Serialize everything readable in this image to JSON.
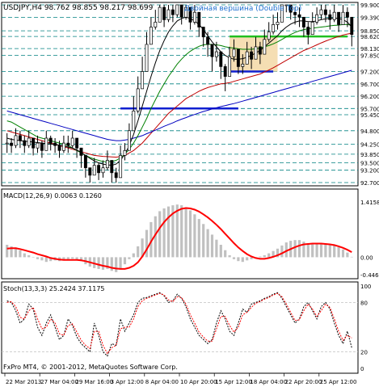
{
  "chart_data": [
    {
      "type": "candlestick",
      "panel": "price",
      "symbol_info": "USDJPY,H4  98.762 98.855 98.217 98.699",
      "pattern_label": "Двойная вершина (Double Top)",
      "y_range": [
        92.7,
        99.9
      ],
      "y_ticks": [
        "99.900",
        "99.390",
        "98.850",
        "98.620",
        "98.130",
        "97.850",
        "97.200",
        "96.700",
        "96.200",
        "95.700",
        "95.450",
        "94.800",
        "94.250",
        "93.850",
        "93.500",
        "93.200",
        "92.700"
      ],
      "x_ticks": [
        "22 Mar 2013",
        "27 Mar 04:00",
        "29 Mar 16:00",
        "3 Apr 12:00",
        "8 Apr 04:00",
        "10 Apr 20:00",
        "15 Apr 12:00",
        "18 Apr 04:00",
        "22 Apr 20:00",
        "25 Apr 12:00"
      ],
      "x_axis_type": "category",
      "dashed_levels": [
        99.9,
        99.39,
        98.85,
        98.62,
        98.13,
        97.85,
        97.2,
        96.7,
        96.2,
        95.7,
        95.45,
        94.8,
        94.25,
        93.85,
        93.5,
        93.2,
        92.7
      ],
      "close": [
        94.3,
        94.2,
        94.6,
        94.4,
        94.2,
        94.5,
        94.1,
        94.3,
        94.0,
        94.5,
        94.3,
        94.2,
        94.0,
        94.3,
        94.2,
        94.5,
        94.1,
        93.8,
        93.3,
        93.0,
        93.4,
        93.1,
        93.3,
        93.6,
        93.1,
        92.9,
        93.8,
        94.0,
        94.8,
        95.6,
        96.5,
        97.2,
        98.3,
        99.0,
        99.2,
        99.8,
        99.3,
        99.7,
        99.5,
        99.9,
        99.4,
        99.8,
        99.2,
        99.6,
        99.0,
        98.6,
        98.3,
        97.8,
        98.0,
        97.4,
        97.0,
        97.8,
        98.1,
        97.4,
        97.5,
        98.0,
        97.7,
        98.2,
        97.9,
        98.5,
        98.8,
        99.1,
        99.2,
        99.9,
        100.0,
        99.6,
        99.5,
        99.4,
        99.0,
        98.7,
        99.2,
        99.5,
        99.7,
        99.5,
        99.3,
        99.6,
        99.1,
        99.6,
        99.4,
        98.7
      ],
      "high": [
        94.7,
        94.5,
        94.9,
        94.8,
        94.6,
        94.8,
        94.5,
        94.6,
        94.4,
        94.8,
        94.6,
        94.5,
        94.4,
        94.6,
        94.6,
        94.8,
        94.5,
        94.1,
        93.7,
        93.3,
        93.7,
        93.5,
        93.6,
        94.0,
        93.4,
        93.3,
        94.2,
        94.3,
        95.1,
        96.2,
        97.0,
        97.8,
        98.8,
        99.4,
        99.7,
        100.0,
        99.9,
        100.0,
        99.9,
        100.0,
        99.9,
        100.0,
        99.7,
        99.9,
        99.5,
        99.0,
        98.8,
        98.2,
        98.4,
        97.9,
        97.5,
        98.2,
        98.5,
        97.9,
        97.9,
        98.4,
        98.2,
        98.6,
        98.4,
        98.9,
        99.2,
        99.5,
        99.6,
        100.0,
        100.0,
        100.0,
        99.8,
        99.8,
        99.4,
        99.2,
        99.6,
        99.8,
        100.0,
        99.9,
        99.7,
        99.9,
        99.5,
        99.9,
        99.8,
        98.85
      ],
      "low": [
        93.9,
        93.9,
        94.1,
        94.1,
        93.9,
        94.1,
        93.8,
        93.9,
        93.7,
        94.1,
        94.0,
        93.9,
        93.7,
        93.9,
        93.9,
        94.1,
        93.7,
        93.3,
        92.9,
        92.7,
        93.0,
        92.8,
        92.9,
        93.2,
        92.7,
        92.7,
        92.9,
        93.6,
        94.0,
        94.8,
        95.5,
        96.5,
        97.2,
        98.3,
        98.9,
        99.2,
        99.0,
        99.2,
        99.2,
        99.4,
        99.1,
        99.3,
        98.9,
        99.1,
        98.6,
        98.2,
        97.8,
        97.2,
        97.6,
        96.9,
        96.4,
        97.0,
        97.6,
        97.1,
        97.1,
        97.5,
        97.3,
        97.7,
        97.5,
        98.0,
        98.4,
        98.7,
        98.9,
        99.2,
        99.6,
        99.3,
        99.1,
        99.0,
        98.6,
        98.3,
        98.7,
        99.1,
        99.3,
        99.2,
        98.9,
        99.2,
        98.8,
        99.1,
        99.0,
        98.217
      ],
      "ma_series": [
        {
          "color": "#c00000",
          "values": [
            94.8,
            94.75,
            94.7,
            94.65,
            94.6,
            94.55,
            94.5,
            94.45,
            94.4,
            94.35,
            94.3,
            94.25,
            94.2,
            94.15,
            94.1,
            94.05,
            94.0,
            93.95,
            93.9,
            93.85,
            93.8,
            93.78,
            93.76,
            93.75,
            93.74,
            93.73,
            93.75,
            93.8,
            93.9,
            94.0,
            94.15,
            94.3,
            94.5,
            94.7,
            94.9,
            95.1,
            95.3,
            95.5,
            95.65,
            95.8,
            95.95,
            96.1,
            96.2,
            96.3,
            96.4,
            96.48,
            96.55,
            96.6,
            96.65,
            96.7,
            96.72,
            96.75,
            96.8,
            96.85,
            96.9,
            96.95,
            97.0,
            97.05,
            97.1,
            97.18,
            97.26,
            97.35,
            97.45,
            97.55,
            97.65,
            97.75,
            97.85,
            97.95,
            98.05,
            98.12,
            98.2,
            98.28,
            98.36,
            98.43,
            98.5,
            98.56,
            98.62,
            98.68,
            98.72,
            98.75
          ]
        },
        {
          "color": "#0000c0",
          "values": [
            95.6,
            95.55,
            95.5,
            95.45,
            95.4,
            95.35,
            95.3,
            95.25,
            95.2,
            95.15,
            95.1,
            95.05,
            95.0,
            94.95,
            94.9,
            94.85,
            94.8,
            94.75,
            94.7,
            94.65,
            94.6,
            94.55,
            94.5,
            94.45,
            94.42,
            94.4,
            94.4,
            94.42,
            94.45,
            94.5,
            94.55,
            94.6,
            94.68,
            94.75,
            94.82,
            94.9,
            94.98,
            95.05,
            95.12,
            95.2,
            95.27,
            95.33,
            95.4,
            95.46,
            95.52,
            95.58,
            95.63,
            95.68,
            95.73,
            95.78,
            95.82,
            95.86,
            95.9,
            95.95,
            96.0,
            96.05,
            96.1,
            96.15,
            96.2,
            96.25,
            96.3,
            96.35,
            96.4,
            96.45,
            96.5,
            96.55,
            96.6,
            96.65,
            96.7,
            96.75,
            96.8,
            96.85,
            96.9,
            96.95,
            97.0,
            97.05,
            97.1,
            97.15,
            97.2,
            97.25
          ]
        },
        {
          "color": "#008000",
          "values": [
            95.2,
            95.15,
            95.05,
            94.95,
            94.85,
            94.75,
            94.65,
            94.55,
            94.5,
            94.45,
            94.4,
            94.35,
            94.3,
            94.25,
            94.2,
            94.1,
            94.0,
            93.9,
            93.8,
            93.72,
            93.65,
            93.6,
            93.55,
            93.55,
            93.55,
            93.6,
            93.7,
            93.85,
            94.05,
            94.3,
            94.6,
            94.95,
            95.3,
            95.7,
            96.05,
            96.4,
            96.7,
            97.0,
            97.25,
            97.5,
            97.7,
            97.88,
            98.02,
            98.13,
            98.22,
            98.28,
            98.3,
            98.3,
            98.28,
            98.25,
            98.2,
            98.17,
            98.15,
            98.12,
            98.1,
            98.1,
            98.1,
            98.12,
            98.15,
            98.2,
            98.25,
            98.32,
            98.4,
            98.5,
            98.6,
            98.7,
            98.78,
            98.85,
            98.9,
            98.93,
            98.95,
            98.98,
            99.0,
            99.02,
            99.05,
            99.07,
            99.08,
            99.1,
            99.1,
            99.08
          ]
        },
        {
          "color": "#000000",
          "values": [
            94.5,
            94.45,
            94.42,
            94.4,
            94.38,
            94.36,
            94.34,
            94.32,
            94.3,
            94.28,
            94.26,
            94.24,
            94.22,
            94.18,
            94.14,
            94.1,
            94.02,
            93.92,
            93.8,
            93.68,
            93.58,
            93.5,
            93.45,
            93.42,
            93.4,
            93.45,
            93.6,
            93.85,
            94.2,
            94.65,
            95.2,
            95.8,
            96.4,
            97.0,
            97.55,
            98.05,
            98.45,
            98.8,
            99.05,
            99.25,
            99.35,
            99.4,
            99.35,
            99.25,
            99.1,
            98.9,
            98.65,
            98.4,
            98.2,
            98.0,
            97.85,
            97.75,
            97.7,
            97.7,
            97.72,
            97.78,
            97.85,
            97.95,
            98.05,
            98.2,
            98.35,
            98.5,
            98.65,
            98.85,
            99.0,
            99.12,
            99.2,
            99.25,
            99.25,
            99.22,
            99.22,
            99.25,
            99.3,
            99.33,
            99.35,
            99.37,
            99.35,
            99.3,
            99.2,
            99.0
          ]
        }
      ],
      "annotations": [
        {
          "type": "hline_blue",
          "y": 95.7,
          "from_bar": 26,
          "to_bar": 53
        },
        {
          "type": "hline_blue",
          "y": 97.2,
          "from_bar": 51,
          "to_bar": 61
        },
        {
          "type": "hline_green",
          "y": 98.62,
          "from_bar": 51,
          "to_bar": 78
        },
        {
          "type": "rect",
          "y_from": 97.2,
          "y_to": 98.62,
          "from_bar": 51,
          "to_bar": 62,
          "color": "#f5deb3"
        }
      ]
    },
    {
      "type": "bar",
      "panel": "macd",
      "label": "MACD(12,26,9) 0.0063 0.1260",
      "y_range": [
        -0.4466,
        1.4158
      ],
      "y_ticks": [
        "1.4158",
        "0.00",
        "-0.4466"
      ],
      "histogram": [
        0.32,
        0.28,
        0.25,
        0.18,
        0.1,
        0.05,
        0.0,
        -0.05,
        -0.08,
        -0.12,
        -0.1,
        -0.08,
        -0.1,
        -0.06,
        -0.05,
        -0.04,
        -0.06,
        -0.1,
        -0.18,
        -0.24,
        -0.28,
        -0.3,
        -0.32,
        -0.3,
        -0.35,
        -0.38,
        -0.3,
        -0.18,
        -0.05,
        0.1,
        0.28,
        0.48,
        0.7,
        0.9,
        1.05,
        1.18,
        1.25,
        1.3,
        1.33,
        1.35,
        1.33,
        1.28,
        1.2,
        1.1,
        0.98,
        0.85,
        0.72,
        0.58,
        0.45,
        0.32,
        0.18,
        0.05,
        -0.05,
        -0.1,
        -0.12,
        -0.08,
        -0.05,
        -0.02,
        0.02,
        0.05,
        0.1,
        0.16,
        0.22,
        0.3,
        0.38,
        0.42,
        0.44,
        0.44,
        0.4,
        0.36,
        0.34,
        0.34,
        0.35,
        0.34,
        0.32,
        0.3,
        0.26,
        0.2,
        0.12,
        0.01
      ],
      "signal": [
        0.22,
        0.23,
        0.23,
        0.21,
        0.18,
        0.15,
        0.12,
        0.08,
        0.05,
        0.02,
        -0.02,
        -0.04,
        -0.06,
        -0.07,
        -0.07,
        -0.07,
        -0.07,
        -0.08,
        -0.1,
        -0.13,
        -0.16,
        -0.19,
        -0.22,
        -0.24,
        -0.27,
        -0.29,
        -0.3,
        -0.3,
        -0.27,
        -0.22,
        -0.13,
        0.02,
        0.2,
        0.4,
        0.58,
        0.75,
        0.9,
        1.02,
        1.12,
        1.19,
        1.24,
        1.26,
        1.25,
        1.22,
        1.17,
        1.1,
        1.02,
        0.93,
        0.83,
        0.72,
        0.6,
        0.48,
        0.36,
        0.25,
        0.16,
        0.08,
        0.02,
        -0.02,
        -0.04,
        -0.04,
        -0.02,
        0.01,
        0.05,
        0.1,
        0.16,
        0.21,
        0.26,
        0.3,
        0.33,
        0.34,
        0.35,
        0.35,
        0.35,
        0.34,
        0.33,
        0.31,
        0.28,
        0.24,
        0.19,
        0.13
      ]
    },
    {
      "type": "line",
      "panel": "stochastic",
      "label": "Stoch(13,3,3) 25.2424 37.1175",
      "y_range": [
        0,
        100
      ],
      "y_ticks": [
        "100",
        "80",
        "20",
        "0"
      ],
      "series": [
        {
          "color": "#000000",
          "dash": true,
          "values": [
            82,
            80,
            70,
            55,
            60,
            78,
            72,
            50,
            40,
            55,
            65,
            50,
            35,
            40,
            60,
            52,
            38,
            30,
            25,
            20,
            55,
            40,
            20,
            15,
            30,
            28,
            60,
            45,
            55,
            65,
            80,
            85,
            86,
            88,
            90,
            92,
            88,
            80,
            82,
            90,
            85,
            75,
            60,
            50,
            40,
            35,
            30,
            35,
            55,
            70,
            60,
            45,
            40,
            55,
            72,
            68,
            78,
            80,
            82,
            85,
            87,
            90,
            92,
            85,
            75,
            65,
            55,
            60,
            75,
            80,
            70,
            60,
            75,
            80,
            72,
            55,
            40,
            30,
            45,
            25
          ]
        },
        {
          "color": "#ff0000",
          "dash": true,
          "values": [
            80,
            81,
            75,
            62,
            60,
            70,
            74,
            60,
            48,
            50,
            60,
            55,
            42,
            40,
            52,
            54,
            44,
            34,
            28,
            24,
            45,
            45,
            28,
            18,
            25,
            28,
            48,
            50,
            50,
            60,
            75,
            82,
            85,
            87,
            89,
            91,
            89,
            83,
            81,
            87,
            86,
            78,
            65,
            55,
            44,
            38,
            33,
            33,
            48,
            63,
            63,
            52,
            44,
            50,
            65,
            68,
            74,
            79,
            81,
            84,
            86,
            89,
            91,
            87,
            78,
            68,
            58,
            59,
            70,
            78,
            72,
            63,
            70,
            78,
            74,
            60,
            45,
            34,
            40,
            37
          ]
        }
      ]
    }
  ],
  "footer": "FxPro MT4, © 2001-2012, MetaQuotes Software Corp.",
  "colors": {
    "background": "#ffffff",
    "grid": "#008080",
    "up_candle": "#ffffff",
    "down_candle": "#000000",
    "macd_hist": "#c0c0c0",
    "macd_signal": "#ff0000"
  }
}
